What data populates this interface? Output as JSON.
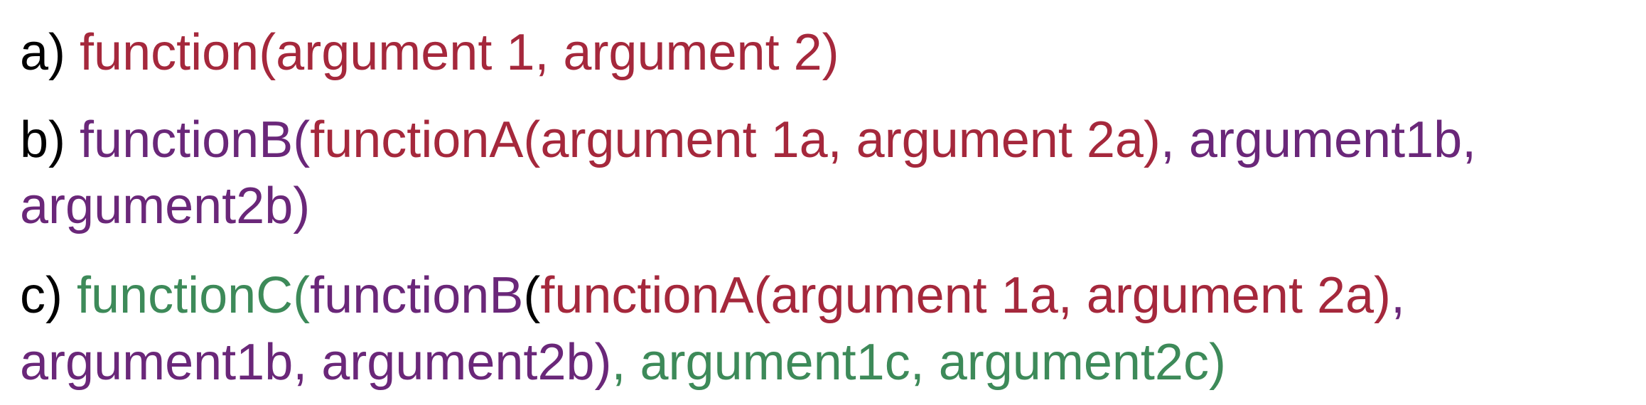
{
  "colors": {
    "label": "#000000",
    "functionA": "#a5283c",
    "functionB": "#6a2779",
    "functionC": "#3d8a59"
  },
  "lines": [
    {
      "segments": [
        {
          "text": "a) ",
          "color": "label"
        },
        {
          "text": "function(argument 1, argument 2)",
          "color": "functionA"
        }
      ]
    },
    {
      "segments": [
        {
          "text": "b) ",
          "color": "label"
        },
        {
          "text": "functionB(",
          "color": "functionB"
        },
        {
          "text": "functionA(argument 1a, argument 2a)",
          "color": "functionA"
        },
        {
          "text": ", argument1b,",
          "color": "functionB"
        }
      ]
    },
    {
      "segments": [
        {
          "text": "argument2b)",
          "color": "functionB"
        }
      ]
    },
    {
      "segments": [
        {
          "text": "c) ",
          "color": "label"
        },
        {
          "text": "functionC(",
          "color": "functionC"
        },
        {
          "text": "functionB",
          "color": "functionB"
        },
        {
          "text": "(",
          "color": "label"
        },
        {
          "text": "functionA(argument 1a, argument 2a)",
          "color": "functionA"
        },
        {
          "text": ",",
          "color": "functionB"
        }
      ]
    },
    {
      "segments": [
        {
          "text": "argument1b, argument2b)",
          "color": "functionB"
        },
        {
          "text": ", argument1c, argument2c)",
          "color": "functionC"
        }
      ]
    }
  ]
}
